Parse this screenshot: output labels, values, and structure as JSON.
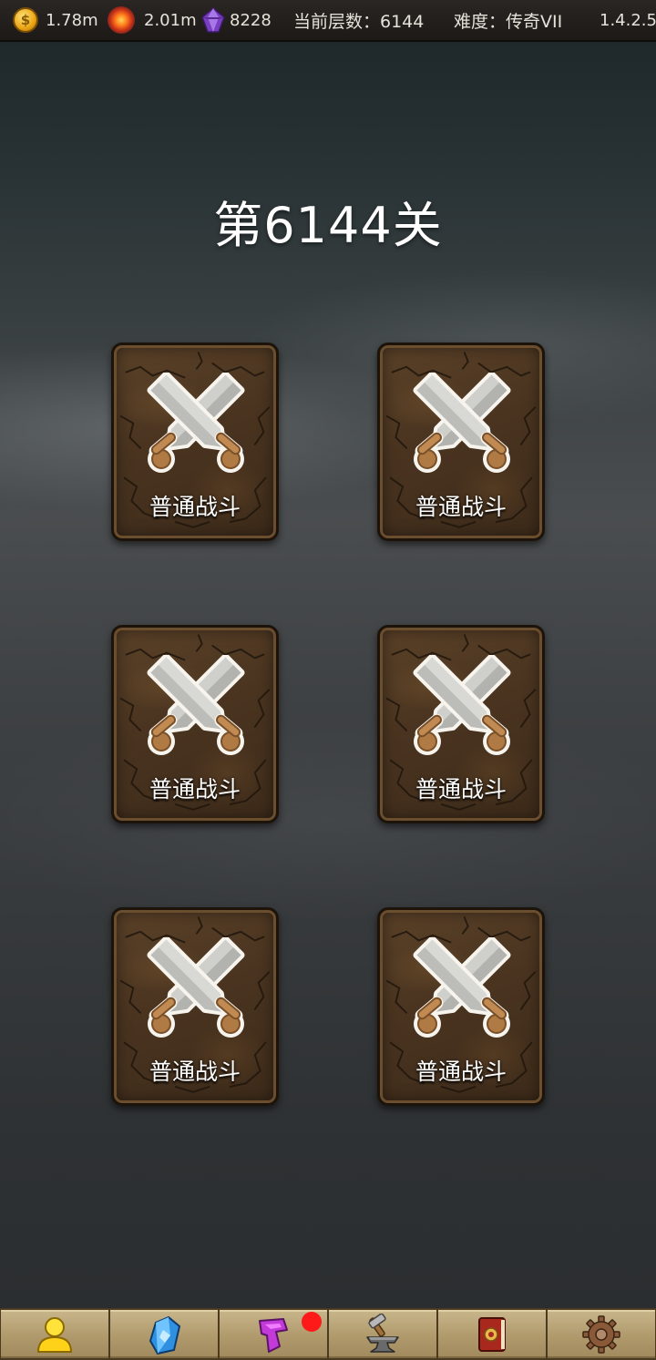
{
  "topbar": {
    "gold": "1.78m",
    "ember": "2.01m",
    "gems": "8228",
    "floor_text": "当前层数：6144",
    "difficulty_text": "难度：传奇VII",
    "version": "1.4.2.5",
    "icons": [
      "gold-coin-icon",
      "ember-icon",
      "purple-gem-icon"
    ]
  },
  "level": {
    "title": "第6144关"
  },
  "battles": [
    {
      "label": "普通战斗",
      "icon": "crossed-swords-icon"
    },
    {
      "label": "普通战斗",
      "icon": "crossed-swords-icon"
    },
    {
      "label": "普通战斗",
      "icon": "crossed-swords-icon"
    },
    {
      "label": "普通战斗",
      "icon": "crossed-swords-icon"
    },
    {
      "label": "普通战斗",
      "icon": "crossed-swords-icon"
    },
    {
      "label": "普通战斗",
      "icon": "crossed-swords-icon"
    }
  ],
  "bottom_nav": {
    "items": [
      {
        "icon": "character-icon"
      },
      {
        "icon": "blue-crystal-icon"
      },
      {
        "icon": "purple-rune-icon",
        "notification": true
      },
      {
        "icon": "anvil-forge-icon"
      },
      {
        "icon": "spellbook-icon"
      },
      {
        "icon": "gear-settings-icon"
      }
    ]
  },
  "colors": {
    "card_border": "#1c130b",
    "card_fill": "#4a3420",
    "nav_fill": "#b09a6c",
    "notification_dot": "#ff1a1a",
    "title_text": "#ffffff"
  }
}
